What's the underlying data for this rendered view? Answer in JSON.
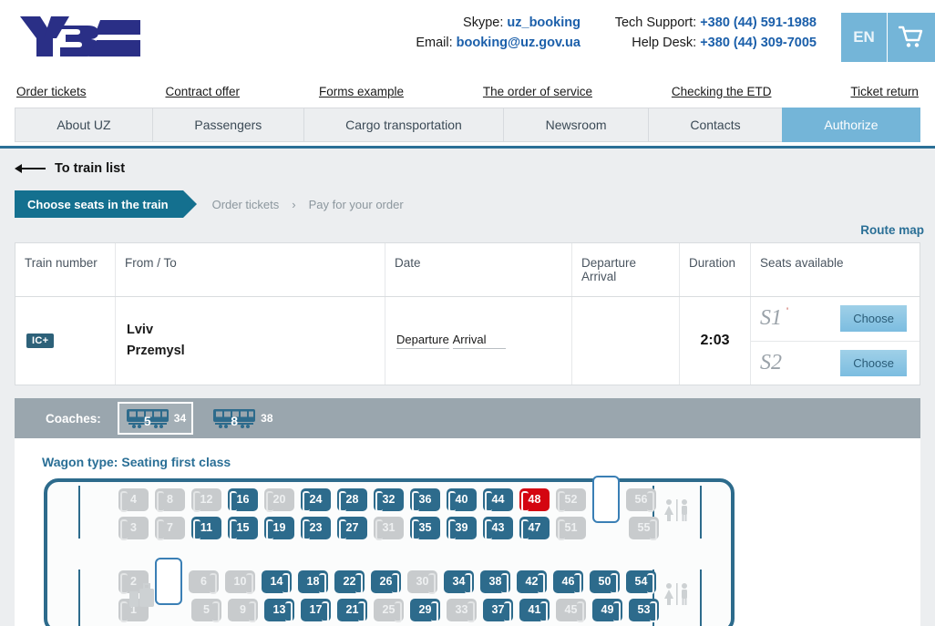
{
  "header": {
    "logo_alt": "UZ Ukrzaliznytsia logo",
    "contacts": [
      {
        "left_label": "Skype:",
        "left_value": "uz_booking",
        "right_label": "Tech Support:",
        "right_value": "+380 (44) 591-1988"
      },
      {
        "left_label": "Email:",
        "left_value": "booking@uz.gov.ua",
        "right_label": "Help Desk:",
        "right_value": "+380 (44) 309-7005"
      }
    ],
    "lang": "EN",
    "cart_icon": "shopping-cart-icon"
  },
  "sublinks": [
    "Order tickets",
    "Contract offer",
    "Forms example",
    "The order of service",
    "Checking the ETD",
    "Ticket return"
  ],
  "tabs": [
    {
      "label": "About UZ",
      "active": false
    },
    {
      "label": "Passengers",
      "active": false
    },
    {
      "label": "Cargo transportation",
      "active": false
    },
    {
      "label": "Newsroom",
      "active": false
    },
    {
      "label": "Contacts",
      "active": false
    },
    {
      "label": "Authorize",
      "active": true
    }
  ],
  "back": {
    "label": "To train list",
    "icon": "arrow-left-icon"
  },
  "stepper": {
    "active": "Choose seats in the train",
    "step2": "Order tickets",
    "separator": "›",
    "step3": "Pay for your order"
  },
  "route_map_link": "Route map",
  "train_table": {
    "headers": {
      "train_number": "Train number",
      "from_to": "From / To",
      "date": "Date",
      "departure_arrival_line1": "Departure",
      "departure_arrival_line2": "Arrival",
      "duration": "Duration",
      "seats_available": "Seats available"
    },
    "row": {
      "badge": "IC+",
      "from": "Lviv",
      "to": "Przemysl",
      "date_departure": "Departure",
      "date_arrival": "Arrival",
      "departure_time": "",
      "arrival_time": "",
      "duration": "2:03",
      "seat_classes": [
        {
          "class": "S1",
          "mark": "'",
          "button": "Choose"
        },
        {
          "class": "S2",
          "mark": "",
          "button": "Choose"
        }
      ]
    }
  },
  "coaches": {
    "label": "Coaches:",
    "items": [
      {
        "number": "5",
        "count": "34",
        "selected": true,
        "icon": "train-coach-icon"
      },
      {
        "number": "8",
        "count": "38",
        "selected": false,
        "icon": "train-coach-icon"
      }
    ]
  },
  "wagon_type_label": "Wagon type: Seating first class",
  "seat_map": {
    "legend_colors": {
      "available": "#2d6b8c",
      "occupied": "#c8cbcd",
      "selected": "#d40511",
      "car_border": "#2d6b8c",
      "empty_outline": "#3a7fb5"
    },
    "icons": {
      "wc": "restroom-icon",
      "luggage": "luggage-icon"
    },
    "top_section": {
      "upper": [
        {
          "n": "4",
          "state": "occupied",
          "bracket": "left"
        },
        {
          "n": "8",
          "state": "occupied",
          "bracket": "left"
        },
        {
          "n": "12",
          "state": "occupied",
          "bracket": "left"
        },
        {
          "n": "16",
          "state": "available",
          "bracket": "left"
        },
        {
          "n": "20",
          "state": "occupied",
          "bracket": "left"
        },
        {
          "n": "24",
          "state": "available",
          "bracket": "left"
        },
        {
          "n": "28",
          "state": "available",
          "bracket": "left"
        },
        {
          "n": "32",
          "state": "available",
          "bracket": "left"
        },
        {
          "n": "36",
          "state": "available",
          "bracket": "left"
        },
        {
          "n": "40",
          "state": "available",
          "bracket": "left"
        },
        {
          "n": "44",
          "state": "available",
          "bracket": "left"
        },
        {
          "n": "48",
          "state": "selected",
          "bracket": "left"
        },
        {
          "n": "52",
          "state": "occupied",
          "bracket": "left"
        },
        {
          "n": "",
          "state": "empty",
          "bracket": "none"
        },
        {
          "n": "56",
          "state": "occupied",
          "bracket": "right"
        }
      ],
      "lower": [
        {
          "n": "3",
          "state": "occupied",
          "bracket": "left"
        },
        {
          "n": "7",
          "state": "occupied",
          "bracket": "left"
        },
        {
          "n": "11",
          "state": "available",
          "bracket": "left"
        },
        {
          "n": "15",
          "state": "available",
          "bracket": "left"
        },
        {
          "n": "19",
          "state": "available",
          "bracket": "left"
        },
        {
          "n": "23",
          "state": "available",
          "bracket": "left"
        },
        {
          "n": "27",
          "state": "available",
          "bracket": "left"
        },
        {
          "n": "31",
          "state": "occupied",
          "bracket": "left"
        },
        {
          "n": "35",
          "state": "available",
          "bracket": "left"
        },
        {
          "n": "39",
          "state": "available",
          "bracket": "left"
        },
        {
          "n": "43",
          "state": "available",
          "bracket": "left"
        },
        {
          "n": "47",
          "state": "available",
          "bracket": "left"
        },
        {
          "n": "51",
          "state": "occupied",
          "bracket": "left"
        },
        {
          "n": "",
          "state": "gap",
          "bracket": "none"
        },
        {
          "n": "55",
          "state": "occupied",
          "bracket": "right"
        }
      ]
    },
    "bottom_section": {
      "upper": [
        {
          "n": "2",
          "state": "occupied",
          "bracket": "left"
        },
        {
          "n": "",
          "state": "empty",
          "bracket": "none"
        },
        {
          "n": "6",
          "state": "occupied",
          "bracket": "right"
        },
        {
          "n": "10",
          "state": "occupied",
          "bracket": "right"
        },
        {
          "n": "14",
          "state": "available",
          "bracket": "right"
        },
        {
          "n": "18",
          "state": "available",
          "bracket": "right"
        },
        {
          "n": "22",
          "state": "available",
          "bracket": "right"
        },
        {
          "n": "26",
          "state": "available",
          "bracket": "right"
        },
        {
          "n": "30",
          "state": "occupied",
          "bracket": "right"
        },
        {
          "n": "34",
          "state": "available",
          "bracket": "right"
        },
        {
          "n": "38",
          "state": "available",
          "bracket": "right"
        },
        {
          "n": "42",
          "state": "available",
          "bracket": "right"
        },
        {
          "n": "46",
          "state": "available",
          "bracket": "right"
        },
        {
          "n": "50",
          "state": "available",
          "bracket": "right"
        },
        {
          "n": "54",
          "state": "available",
          "bracket": "right"
        }
      ],
      "lower": [
        {
          "n": "1",
          "state": "occupied",
          "bracket": "left"
        },
        {
          "n": "",
          "state": "gap",
          "bracket": "none"
        },
        {
          "n": "5",
          "state": "occupied",
          "bracket": "right"
        },
        {
          "n": "9",
          "state": "occupied",
          "bracket": "right"
        },
        {
          "n": "13",
          "state": "available",
          "bracket": "right"
        },
        {
          "n": "17",
          "state": "available",
          "bracket": "right"
        },
        {
          "n": "21",
          "state": "available",
          "bracket": "right"
        },
        {
          "n": "25",
          "state": "occupied",
          "bracket": "right"
        },
        {
          "n": "29",
          "state": "available",
          "bracket": "right"
        },
        {
          "n": "33",
          "state": "occupied",
          "bracket": "right"
        },
        {
          "n": "37",
          "state": "available",
          "bracket": "right"
        },
        {
          "n": "41",
          "state": "available",
          "bracket": "right"
        },
        {
          "n": "45",
          "state": "occupied",
          "bracket": "right"
        },
        {
          "n": "49",
          "state": "available",
          "bracket": "right"
        },
        {
          "n": "53",
          "state": "available",
          "bracket": "right"
        }
      ]
    }
  }
}
